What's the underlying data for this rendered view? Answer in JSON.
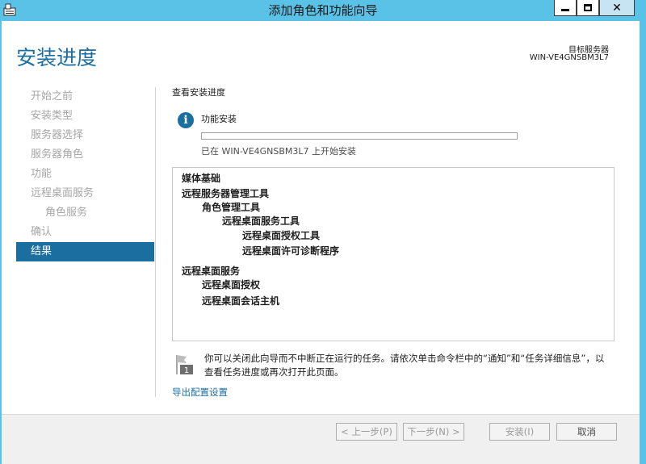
{
  "window": {
    "title": "添加角色和功能向导",
    "close_glyph": "✕"
  },
  "header": {
    "page_title": "安装进度",
    "target_label": "目标服务器",
    "target_name": "WIN-VE4GNSBM3L7"
  },
  "nav": {
    "items": [
      {
        "label": "开始之前",
        "state": "disabled"
      },
      {
        "label": "安装类型",
        "state": "disabled"
      },
      {
        "label": "服务器选择",
        "state": "disabled"
      },
      {
        "label": "服务器角色",
        "state": "disabled"
      },
      {
        "label": "功能",
        "state": "disabled"
      },
      {
        "label": "远程桌面服务",
        "state": "disabled"
      },
      {
        "label": "角色服务",
        "state": "disabled"
      },
      {
        "label": "确认",
        "state": "disabled"
      },
      {
        "label": "结果",
        "state": "active"
      }
    ]
  },
  "main": {
    "section_title": "查看安装进度",
    "info_glyph": "i",
    "feature_label": "功能安装",
    "progress_fraction": 0.0,
    "status": "已在 WIN-VE4GNSBM3L7 上开始安装",
    "results": [
      {
        "label": "媒体基础",
        "level": 0
      },
      {
        "label": "远程服务器管理工具",
        "level": 0
      },
      {
        "label": "角色管理工具",
        "level": 1
      },
      {
        "label": "远程桌面服务工具",
        "level": 2
      },
      {
        "label": "远程桌面授权工具",
        "level": 3
      },
      {
        "label": "远程桌面许可诊断程序",
        "level": 3
      },
      {
        "label": "远程桌面服务",
        "level": 0
      },
      {
        "label": "远程桌面授权",
        "level": 1
      },
      {
        "label": "远程桌面会话主机",
        "level": 1
      }
    ],
    "note_line1": "你可以关闭此向导而不中断正在运行的任务。请依次单击命令栏中的“通知”和“任务详细信息”，以",
    "note_line2": "查看任务进度或再次打开此页面。",
    "export_link": "导出配置设置"
  },
  "footer": {
    "prev": "< 上一步(P)",
    "next": "下一步(N) >",
    "install": "安装(I)",
    "cancel": "取消"
  },
  "colors": {
    "titlebar": "#5bc2e7",
    "accent": "#1a6ea0",
    "nav_disabled": "#a6a6a6"
  }
}
